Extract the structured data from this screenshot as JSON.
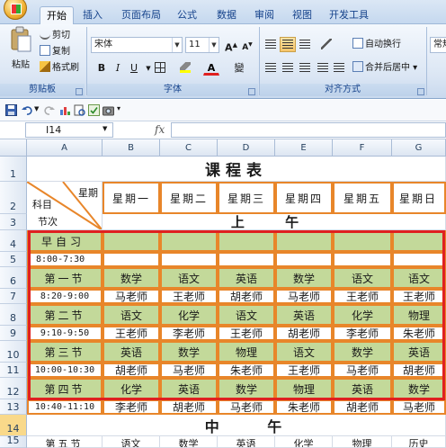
{
  "ribbon": {
    "tabs": [
      "开始",
      "插入",
      "页面布局",
      "公式",
      "数据",
      "审阅",
      "视图",
      "开发工具"
    ],
    "clipboard": {
      "paste": "粘贴",
      "cut": "剪切",
      "copy": "复制",
      "format_painter": "格式刷",
      "label": "剪贴板"
    },
    "font": {
      "name": "宋体",
      "size": "11",
      "grow": "A",
      "shrink": "A",
      "bold": "B",
      "italic": "I",
      "underline": "U",
      "color_letter": "A",
      "phonetic": "變",
      "label": "字体"
    },
    "alignment": {
      "wrap": "自动换行",
      "merge": "合并后居中",
      "label": "对齐方式"
    },
    "number": {
      "format": "常规"
    }
  },
  "formula_bar": {
    "cell": "I14",
    "fx": "fx",
    "value": ""
  },
  "columns": [
    "A",
    "B",
    "C",
    "D",
    "E",
    "F",
    "G"
  ],
  "rows": [
    "1",
    "2",
    "3",
    "4",
    "5",
    "6",
    "7",
    "8",
    "9",
    "10",
    "11",
    "12",
    "13",
    "14",
    "15"
  ],
  "sheet": {
    "title": "课程表",
    "corner_top": "星期",
    "corner_left": "科目",
    "corner_bottom": "节次",
    "days": [
      "星期一",
      "星期二",
      "星期三",
      "星期四",
      "星期五",
      "星期日"
    ],
    "morning": "上  午",
    "noon": "中  午",
    "r4": "早自习",
    "r5": "8:00-7:30",
    "r6": {
      "a": "第一节",
      "v": [
        "数学",
        "语文",
        "英语",
        "数学",
        "语文",
        "语文"
      ]
    },
    "r7": {
      "a": "8:20-9:00",
      "v": [
        "马老师",
        "王老师",
        "胡老师",
        "马老师",
        "王老师",
        "王老师"
      ]
    },
    "r8": {
      "a": "第二节",
      "v": [
        "语文",
        "化学",
        "语文",
        "英语",
        "化学",
        "物理"
      ]
    },
    "r9": {
      "a": "9:10-9:50",
      "v": [
        "王老师",
        "李老师",
        "王老师",
        "胡老师",
        "李老师",
        "朱老师"
      ]
    },
    "r10": {
      "a": "第三节",
      "v": [
        "英语",
        "数学",
        "物理",
        "语文",
        "数学",
        "英语"
      ]
    },
    "r11": {
      "a": "10:00-10:30",
      "v": [
        "胡老师",
        "马老师",
        "朱老师",
        "王老师",
        "马老师",
        "胡老师"
      ]
    },
    "r12": {
      "a": "第四节",
      "v": [
        "化学",
        "英语",
        "数学",
        "物理",
        "英语",
        "数学"
      ]
    },
    "r13": {
      "a": "10:40-11:10",
      "v": [
        "李老师",
        "胡老师",
        "马老师",
        "朱老师",
        "胡老师",
        "马老师"
      ]
    },
    "r15": {
      "a": "第五节",
      "v": [
        "语文",
        "数学",
        "英语",
        "化学",
        "物理",
        "历史"
      ]
    }
  }
}
